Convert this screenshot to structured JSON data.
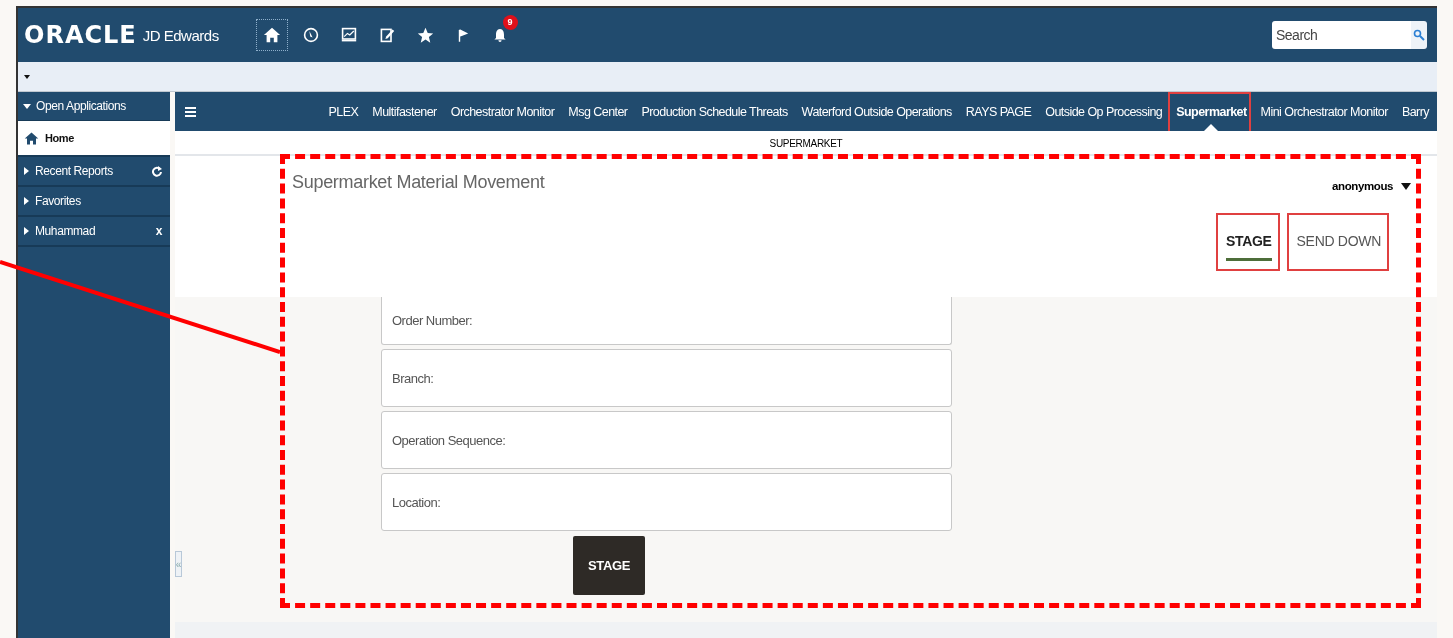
{
  "header": {
    "logo": "ORACLE",
    "product": "JD Edwards",
    "notification_count": "9",
    "search": {
      "placeholder": "Search"
    }
  },
  "sidebar": {
    "heading": "Open Applications",
    "items": [
      {
        "label": "Home",
        "kind": "home",
        "selected": true
      },
      {
        "label": "Recent Reports",
        "kind": "refresh",
        "selected": false
      },
      {
        "label": "Favorites",
        "kind": "plain",
        "selected": false
      },
      {
        "label": "Muhammad",
        "kind": "close",
        "selected": false,
        "close_glyph": "x"
      }
    ]
  },
  "collapse_glyph": "«",
  "tabs": [
    {
      "label": "PLEX",
      "selected": false
    },
    {
      "label": "Multifastener",
      "selected": false
    },
    {
      "label": "Orchestrator Monitor",
      "selected": false
    },
    {
      "label": "Msg Center",
      "selected": false
    },
    {
      "label": "Production Schedule Threats",
      "selected": false
    },
    {
      "label": "Waterford Outside Operations",
      "selected": false
    },
    {
      "label": "RAYS PAGE",
      "selected": false
    },
    {
      "label": "Outside Op Processing",
      "selected": false
    },
    {
      "label": "Supermarket",
      "selected": true
    },
    {
      "label": "Mini Orchestrator Monitor",
      "selected": false
    },
    {
      "label": "Barry",
      "selected": false
    }
  ],
  "page": {
    "label": "SUPERMARKET",
    "title": "Supermarket Material Movement",
    "user": "anonymous",
    "view_tabs": [
      {
        "label": "STAGE",
        "selected": true
      },
      {
        "label": "SEND DOWN",
        "selected": false
      }
    ],
    "fields": [
      {
        "placeholder": "Order Number:"
      },
      {
        "placeholder": "Branch:"
      },
      {
        "placeholder": "Operation Sequence:"
      },
      {
        "placeholder": "Location:"
      }
    ],
    "button": "STAGE"
  }
}
